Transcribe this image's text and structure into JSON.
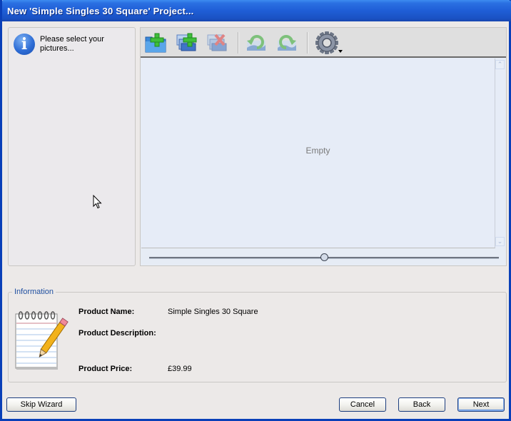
{
  "window": {
    "title": "New 'Simple Singles 30 Square' Project..."
  },
  "left_panel": {
    "icon": "info-icon",
    "instruction": "Please select your pictures..."
  },
  "toolbar": {
    "buttons": [
      {
        "name": "add-folder",
        "icon": "folder-add-icon",
        "enabled": true
      },
      {
        "name": "add-pictures",
        "icon": "pictures-add-icon",
        "enabled": true
      },
      {
        "name": "remove-pictures",
        "icon": "pictures-remove-icon",
        "enabled": false
      },
      {
        "name": "rotate-left",
        "icon": "rotate-left-icon",
        "enabled": false
      },
      {
        "name": "rotate-right",
        "icon": "rotate-right-icon",
        "enabled": false
      },
      {
        "name": "settings",
        "icon": "gear-icon",
        "has_dropdown": true,
        "enabled": true
      }
    ]
  },
  "pictures": {
    "empty_text": "Empty",
    "thumbnail_size_slider": 0.5
  },
  "information": {
    "legend": "Information",
    "icon": "notepad-pencil-icon",
    "fields": [
      {
        "label": "Product Name:",
        "value": "Simple Singles 30 Square"
      },
      {
        "label": "Product Description:",
        "value": ""
      },
      {
        "label": "Product Price:",
        "value": "£39.99"
      }
    ]
  },
  "footer": {
    "skip_label": "Skip Wizard",
    "cancel_label": "Cancel",
    "back_label": "Back",
    "next_label": "Next"
  },
  "colors": {
    "titlebar": "#1f5ed6",
    "legend_text": "#1f4fa0",
    "panel_bg": "#e6ecf7"
  }
}
